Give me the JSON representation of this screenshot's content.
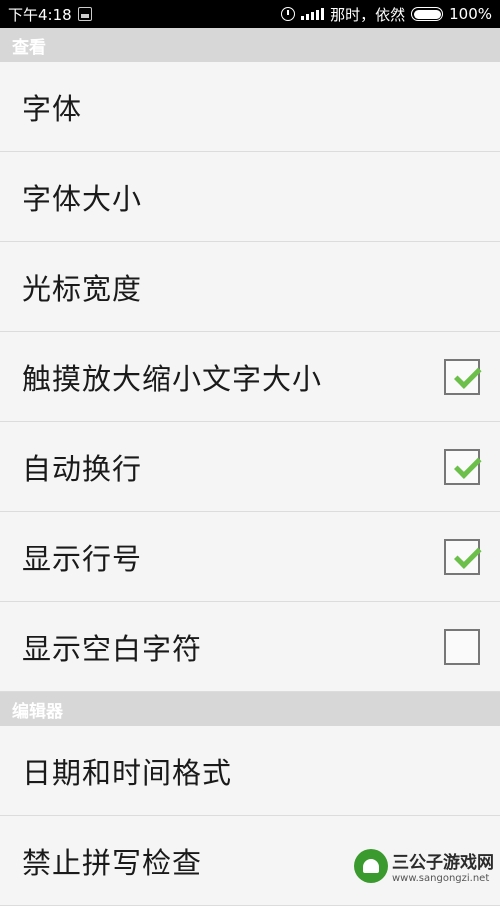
{
  "status_bar": {
    "time": "下午4:18",
    "carrier": "那时，依然",
    "battery": "100%"
  },
  "sections": [
    {
      "title": "查看",
      "items": [
        {
          "label": "字体"
        },
        {
          "label": "字体大小"
        },
        {
          "label": "光标宽度"
        },
        {
          "label": "触摸放大缩小文字大小",
          "checked": true
        },
        {
          "label": "自动换行",
          "checked": true
        },
        {
          "label": "显示行号",
          "checked": true
        },
        {
          "label": "显示空白字符",
          "checked": false
        }
      ]
    },
    {
      "title": "编辑器",
      "items": [
        {
          "label": "日期和时间格式"
        },
        {
          "label": "禁止拼写检查"
        }
      ]
    }
  ],
  "watermark": {
    "title": "三公子游戏网",
    "url": "www.sangongzi.net"
  },
  "colors": {
    "check": "#6cc04a",
    "section_header_bg": "#d7d7d7"
  }
}
